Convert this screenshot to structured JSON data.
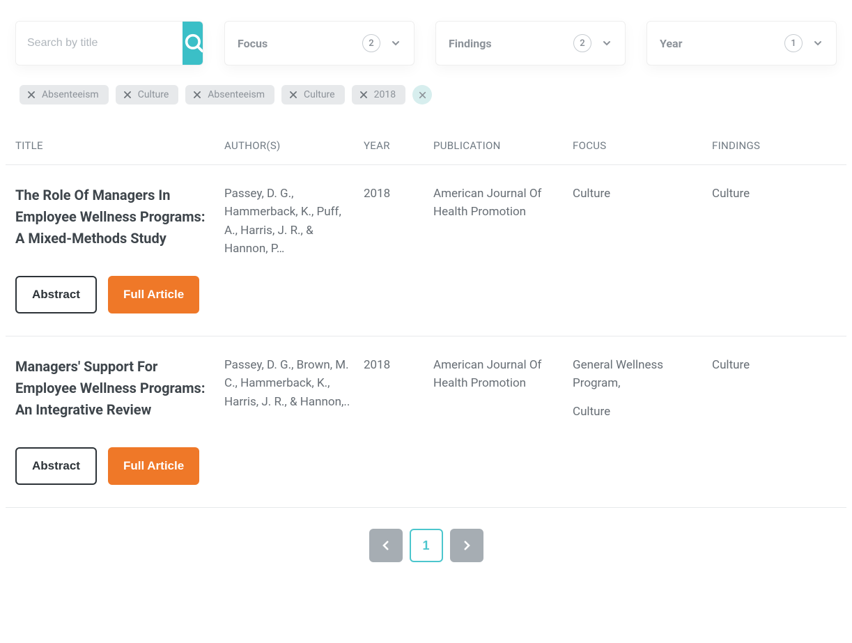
{
  "search": {
    "placeholder": "Search by title"
  },
  "filters": [
    {
      "label": "Focus",
      "count": "2"
    },
    {
      "label": "Findings",
      "count": "2"
    },
    {
      "label": "Year",
      "count": "1"
    }
  ],
  "chips": [
    {
      "label": "Absenteeism"
    },
    {
      "label": "Culture"
    },
    {
      "label": "Absenteeism"
    },
    {
      "label": "Culture"
    },
    {
      "label": "2018"
    }
  ],
  "columns": {
    "title": "TITLE",
    "authors": "AUTHOR(S)",
    "year": "YEAR",
    "publication": "PUBLICATION",
    "focus": "FOCUS",
    "findings": "FINDINGS"
  },
  "button_labels": {
    "abstract": "Abstract",
    "full": "Full Article"
  },
  "rows": [
    {
      "title": "The Role Of Managers In Employee Wellness Programs: A Mixed-Methods Study",
      "authors": "Passey, D. G., Hammerback, K., Puff, A., Harris, J. R., & Hannon, P…",
      "year": "2018",
      "publication": "American Journal Of Health Promotion",
      "focus": [
        "Culture"
      ],
      "findings": "Culture"
    },
    {
      "title": "Managers' Support For Employee Wellness Programs: An Integrative Review",
      "authors": "Passey, D. G., Brown, M. C., Hammerback, K., Harris, J. R., & Hannon,..",
      "year": "2018",
      "publication": "American Journal Of Health Promotion",
      "focus": [
        "General Wellness Program,",
        "Culture"
      ],
      "findings": "Culture"
    }
  ],
  "pagination": {
    "current": "1"
  }
}
